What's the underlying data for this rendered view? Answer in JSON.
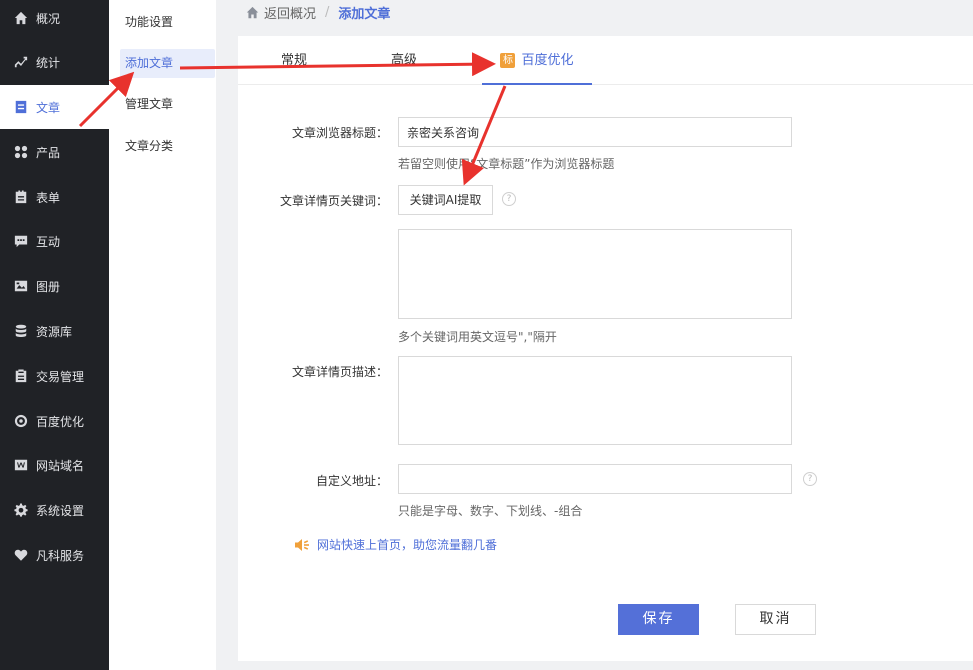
{
  "sidebar": {
    "items": [
      {
        "label": "概况",
        "icon": "home-icon"
      },
      {
        "label": "统计",
        "icon": "chart-icon"
      },
      {
        "label": "文章",
        "icon": "article-icon",
        "active": true
      },
      {
        "label": "产品",
        "icon": "grid-icon"
      },
      {
        "label": "表单",
        "icon": "form-icon"
      },
      {
        "label": "互动",
        "icon": "chat-icon"
      },
      {
        "label": "图册",
        "icon": "album-icon"
      },
      {
        "label": "资源库",
        "icon": "database-icon"
      },
      {
        "label": "交易管理",
        "icon": "clipboard-icon"
      },
      {
        "label": "百度优化",
        "icon": "target-icon"
      },
      {
        "label": "网站域名",
        "icon": "domain-icon"
      },
      {
        "label": "系统设置",
        "icon": "gear-icon"
      },
      {
        "label": "凡科服务",
        "icon": "heart-icon"
      }
    ]
  },
  "subnav": {
    "items": [
      {
        "label": "功能设置"
      },
      {
        "label": "添加文章",
        "active": true
      },
      {
        "label": "管理文章"
      },
      {
        "label": "文章分类"
      }
    ]
  },
  "breadcrumb": {
    "back": "返回概况",
    "separator": "/",
    "current": "添加文章"
  },
  "tabs": {
    "general": "常规",
    "advanced": "高级",
    "baidu_badge": "标",
    "baidu": "百度优化"
  },
  "form": {
    "browser_title_label": "文章浏览器标题：",
    "browser_title_value": "亲密关系咨询",
    "browser_title_hint": "若留空则使用“文章标题”作为浏览器标题",
    "keywords_label": "文章详情页关键词：",
    "ai_button": "关键词AI提取",
    "help_mark": "?",
    "keywords_value": "",
    "keywords_hint": "多个关键词用英文逗号\",\"隔开",
    "description_label": "文章详情页描述：",
    "description_value": "",
    "custom_url_label": "自定义地址：",
    "custom_url_value": "",
    "custom_url_hint": "只能是字母、数字、下划线、-组合",
    "promo": "网站快速上首页，助您流量翻几番",
    "save": "保存",
    "cancel": "取消"
  },
  "colors": {
    "sidebar_bg": "#202226",
    "accent": "#4f6fd8",
    "save_button": "#5470d8",
    "badge": "#f0a03a",
    "annotation_arrow": "#e8322d"
  }
}
